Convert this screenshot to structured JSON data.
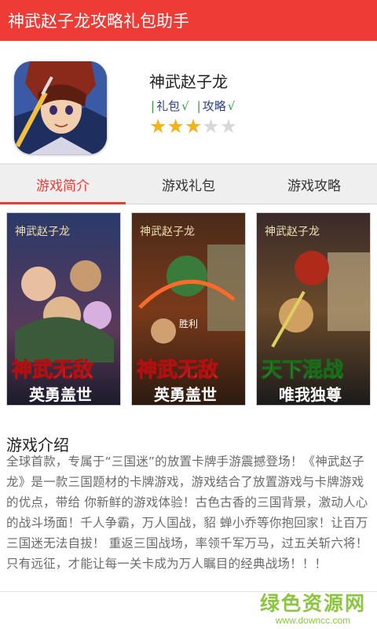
{
  "topbar": {
    "title": "神武赵子龙攻略礼包助手"
  },
  "app": {
    "name": "神武赵子龙",
    "tags": [
      {
        "label": "礼包",
        "check": "√"
      },
      {
        "label": "攻略",
        "check": "√"
      }
    ],
    "rating": {
      "value": 3,
      "max": 5
    }
  },
  "tabs": [
    {
      "label": "游戏简介",
      "active": true
    },
    {
      "label": "游戏礼包",
      "active": false
    },
    {
      "label": "游戏攻略",
      "active": false
    }
  ],
  "screenshots": [
    {
      "logo": "神武赵子龙",
      "line1": "神武无敌",
      "line2": "英勇盖世"
    },
    {
      "logo": "神武赵子龙",
      "line1": "神武无敌",
      "line2": "英勇盖世",
      "extra": "胜利"
    },
    {
      "logo": "神武赵子龙",
      "line1": "天下混战",
      "line2": "唯我独尊"
    }
  ],
  "intro": {
    "title": "游戏介绍",
    "text": "全球首款，专属于“三国迷”的放置卡牌手游震撼登场！《神武赵子龙》是一款三国题材的卡牌游戏，游戏结合了放置游戏与卡牌游戏的优点，带给 你新鲜的游戏体验！古色古香的三国背景，激动人心的战斗场面！千人争霸，万人国战，貂 蝉小乔等你抱回家！让百万三国迷无法自拔！ 重返三国战场，率领千军万马，过五关斩六将！只有远征，才能让每一关卡成为万人瞩目的经典战场！！！"
  },
  "watermark": {
    "main": "绿色资源网",
    "sub": "www.downcc.com"
  },
  "colors": {
    "accent": "#ef3b36",
    "star": "#f2b21a",
    "tag_check": "#2f9a3a",
    "watermark": "#8cc63f"
  }
}
